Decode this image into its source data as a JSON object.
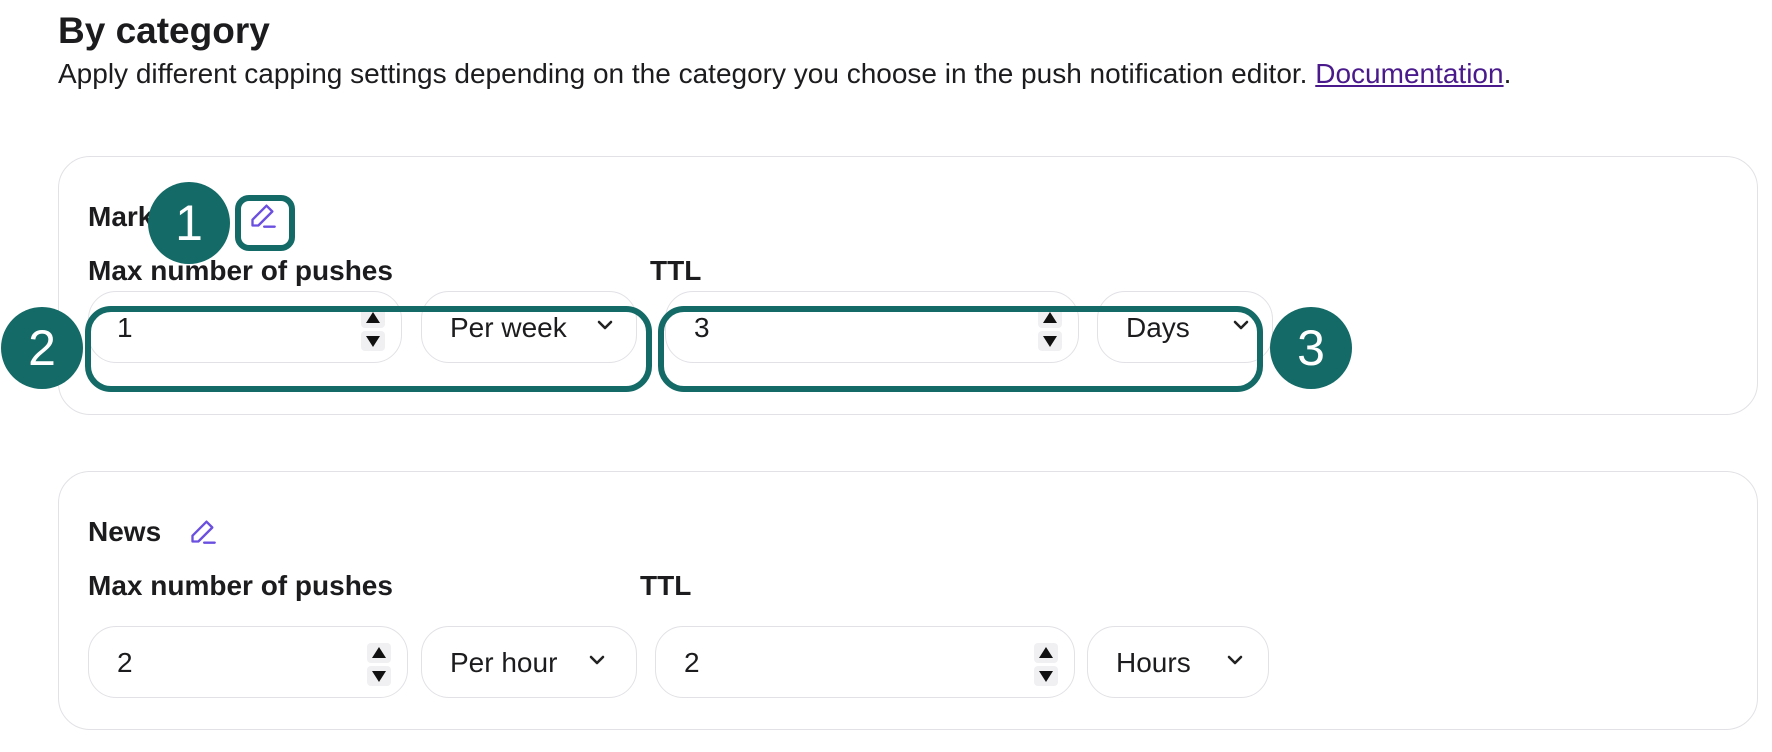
{
  "header": {
    "title": "By category",
    "description": "Apply different capping settings depending on the category you choose in the push notification editor.",
    "doc_link": "Documentation",
    "period": "."
  },
  "categories": [
    {
      "name": "Marketing",
      "max_pushes_label": "Max number of pushes",
      "max_pushes_value": "1",
      "frequency": "Per week",
      "ttl_label": "TTL",
      "ttl_value": "3",
      "ttl_unit": "Days"
    },
    {
      "name": "News",
      "max_pushes_label": "Max number of pushes",
      "max_pushes_value": "2",
      "frequency": "Per hour",
      "ttl_label": "TTL",
      "ttl_value": "2",
      "ttl_unit": "Hours"
    }
  ],
  "annotations": [
    "1",
    "2",
    "3"
  ],
  "icons": {
    "edit": "pencil-edit-icon",
    "dropdown": "chevron-down-icon",
    "spinner": "number-spinner-icon"
  },
  "colors": {
    "annotation": "#136a66",
    "edit_icon": "#6a4fe0",
    "link": "#4a1a8c"
  }
}
